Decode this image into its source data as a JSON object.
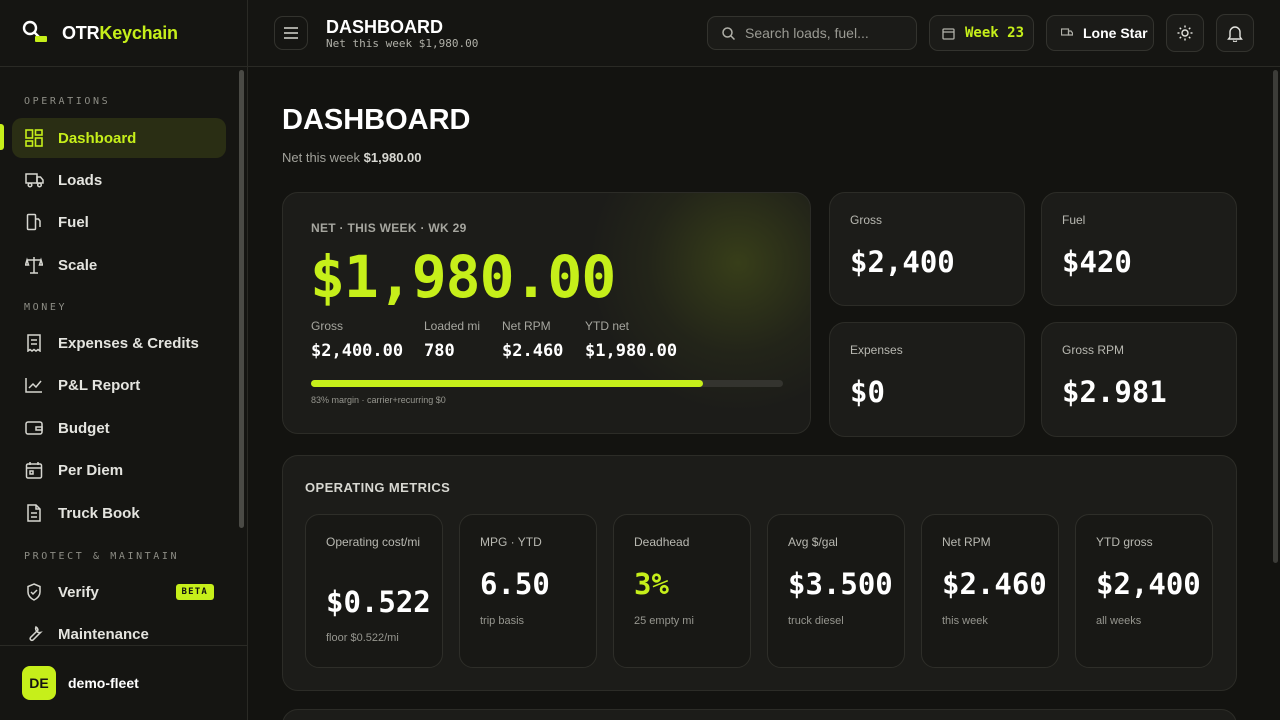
{
  "app": {
    "brand_a": "OTR",
    "brand_b": "Keychain",
    "accent": "#c6ef1a"
  },
  "sidebar": {
    "sections": [
      "OPERATIONS",
      "MONEY",
      "PROTECT & MAINTAIN"
    ],
    "items": [
      {
        "label": "Dashboard",
        "icon": "dashboard-icon"
      },
      {
        "label": "Loads",
        "icon": "truck-icon"
      },
      {
        "label": "Fuel",
        "icon": "fuel-icon"
      },
      {
        "label": "Scale",
        "icon": "scale-icon"
      },
      {
        "label": "Expenses & Credits",
        "icon": "receipt-icon"
      },
      {
        "label": "P&L Report",
        "icon": "chart-icon"
      },
      {
        "label": "Budget",
        "icon": "wallet-icon"
      },
      {
        "label": "Per Diem",
        "icon": "calendar-icon"
      },
      {
        "label": "Truck Book",
        "icon": "document-icon"
      },
      {
        "label": "Verify",
        "icon": "shield-icon",
        "badge": "BETA"
      },
      {
        "label": "Maintenance",
        "icon": "wrench-icon"
      }
    ],
    "user": {
      "initials": "DE",
      "name": "demo-fleet"
    }
  },
  "header": {
    "title": "DASHBOARD",
    "subtitle": "Net this week $1,980.00",
    "search_placeholder": "Search loads, fuel...",
    "week": "Week 23",
    "truck": "Lone Star"
  },
  "page": {
    "title": "DASHBOARD",
    "subtitle_prefix": "Net this week ",
    "subtitle_value": "$1,980.00"
  },
  "hero": {
    "label": "NET · THIS WEEK · WK 29",
    "value": "$1,980.00",
    "stats": [
      {
        "label": "Gross",
        "value": "$2,400.00"
      },
      {
        "label": "Loaded mi",
        "value": "780"
      },
      {
        "label": "Net RPM",
        "value": "$2.460"
      },
      {
        "label": "YTD net",
        "value": "$1,980.00"
      }
    ],
    "margin_pct": 83,
    "note": "83% margin · carrier+recurring $0"
  },
  "mini_cards": [
    {
      "label": "Gross",
      "value": "$2,400"
    },
    {
      "label": "Fuel",
      "value": "$420"
    },
    {
      "label": "Expenses",
      "value": "$0"
    },
    {
      "label": "Gross RPM",
      "value": "$2.981"
    }
  ],
  "operating_metrics": {
    "title": "OPERATING METRICS",
    "items": [
      {
        "label": "Operating cost/mi",
        "value": "$0.522",
        "sub": "floor $0.522/mi"
      },
      {
        "label": "MPG · YTD",
        "value": "6.50",
        "sub": "trip basis"
      },
      {
        "label": "Deadhead",
        "value": "3%",
        "sub": "25 empty mi",
        "accent": true
      },
      {
        "label": "Avg $/gal",
        "value": "$3.500",
        "sub": "truck diesel"
      },
      {
        "label": "Net RPM",
        "value": "$2.460",
        "sub": "this week"
      },
      {
        "label": "YTD gross",
        "value": "$2,400",
        "sub": "all weeks"
      }
    ]
  }
}
